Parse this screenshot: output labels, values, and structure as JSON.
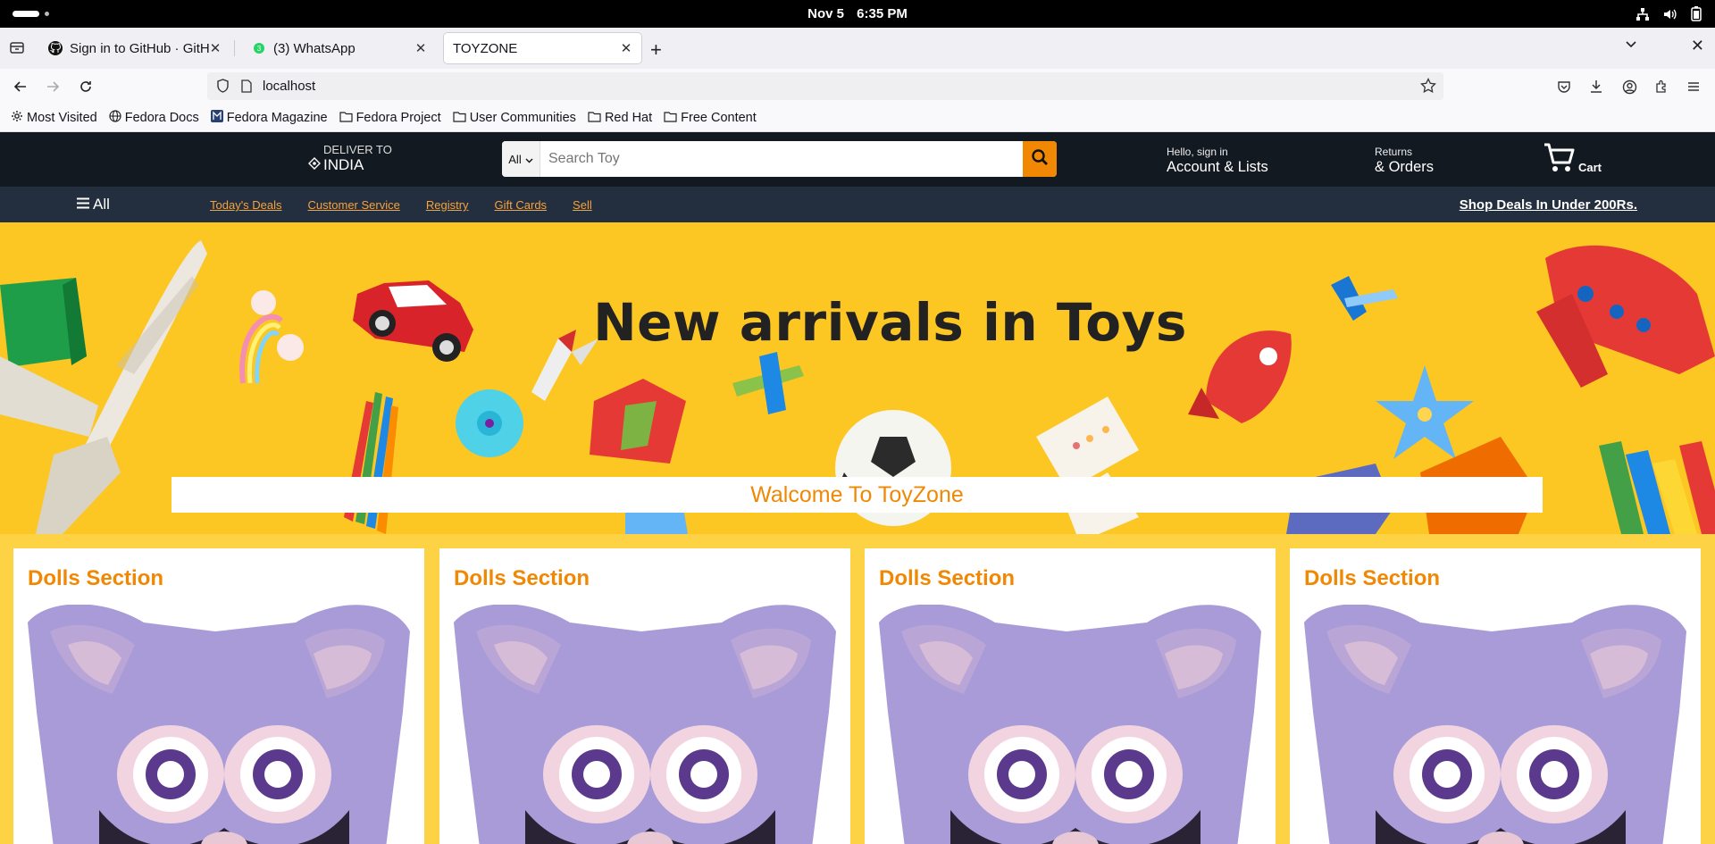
{
  "os": {
    "date": "Nov 5",
    "time": "6:35 PM"
  },
  "browser": {
    "tabs": [
      {
        "title": "Sign in to GitHub · GitHub",
        "icon": "github-icon"
      },
      {
        "title": "(3) WhatsApp",
        "icon": "whatsapp-icon",
        "badge": "3"
      },
      {
        "title": "TOYZONE",
        "icon": "none",
        "active": true
      }
    ],
    "url": "localhost",
    "bookmarks": [
      {
        "label": "Most Visited",
        "icon": "gear-icon"
      },
      {
        "label": "Fedora Docs",
        "icon": "globe-icon"
      },
      {
        "label": "Fedora Magazine",
        "icon": "fedora-magazine-icon"
      },
      {
        "label": "Fedora Project",
        "icon": "folder-icon"
      },
      {
        "label": "User Communities",
        "icon": "folder-icon"
      },
      {
        "label": "Red Hat",
        "icon": "folder-icon"
      },
      {
        "label": "Free Content",
        "icon": "folder-icon"
      }
    ]
  },
  "site": {
    "deliver_label": "DELIVER TO",
    "deliver_location": "INDIA",
    "search_category": "All",
    "search_placeholder": "Search Toy",
    "account_line1": "Hello, sign in",
    "account_line2": "Account & Lists",
    "returns_line1": "Returns",
    "returns_line2": "& Orders",
    "cart_label": "Cart",
    "all_menu": "All",
    "nav_links": [
      "Today's Deals",
      "Customer Service",
      "Registry",
      "Gift Cards",
      "Sell"
    ],
    "deals_banner": "Shop Deals In Under 200Rs.",
    "hero_title": "New arrivals in Toys",
    "welcome": "Walcome To ToyZone",
    "cards": [
      {
        "title": "Dolls Section"
      },
      {
        "title": "Dolls Section"
      },
      {
        "title": "Dolls Section"
      },
      {
        "title": "Dolls Section"
      }
    ]
  },
  "colors": {
    "header_bg": "#131921",
    "subnav_bg": "#232f3e",
    "accent_orange": "#f08804",
    "hero_yellow": "#fcc623",
    "cards_bg": "#fdd345"
  }
}
